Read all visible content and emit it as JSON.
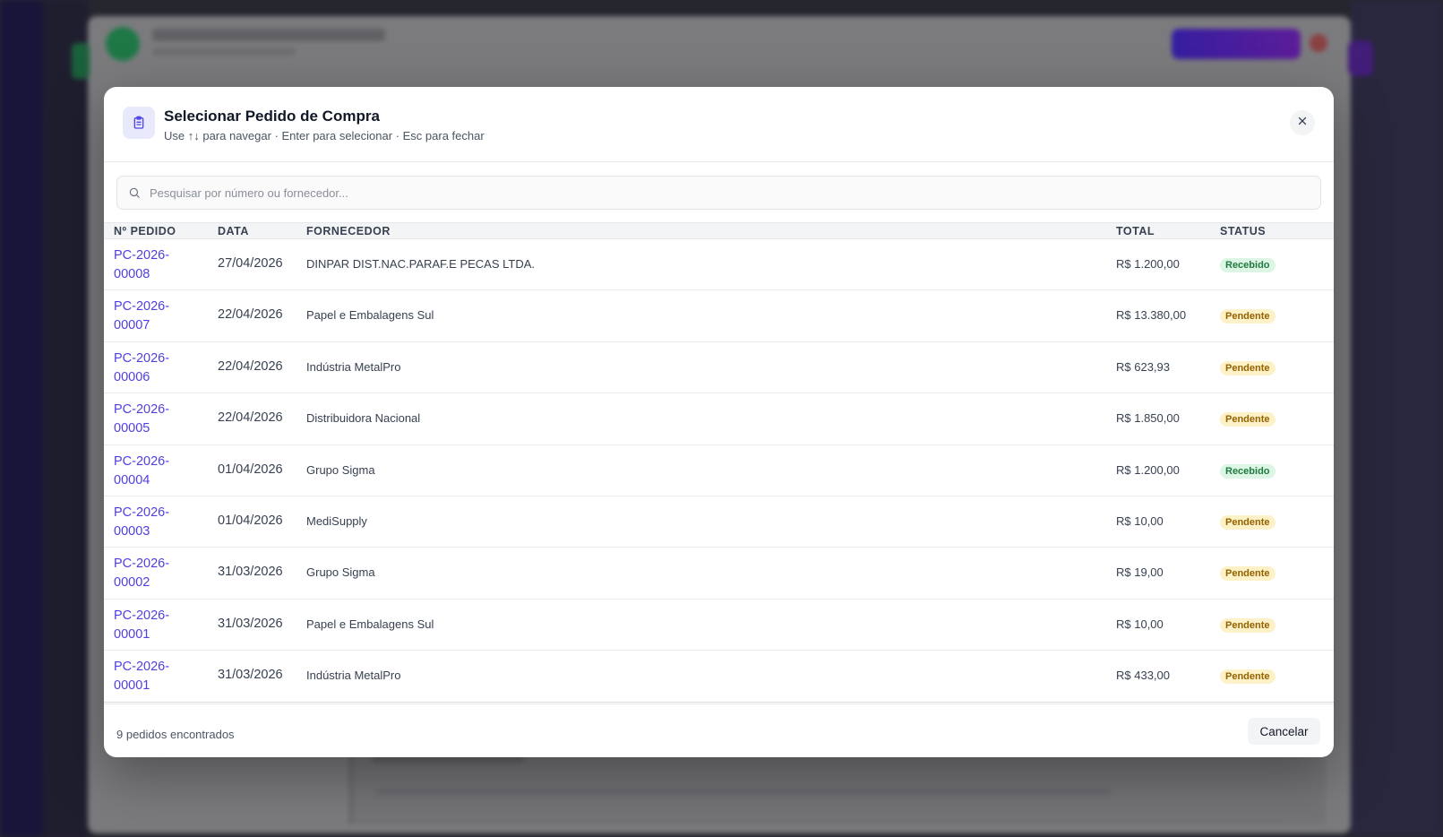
{
  "modal": {
    "title": "Selecionar Pedido de Compra",
    "subtitle": "Use ↑↓ para navegar · Enter para selecionar · Esc para fechar",
    "close_icon": "close-icon",
    "header_icon": "clipboard-icon"
  },
  "search": {
    "placeholder": "Pesquisar por número ou fornecedor...",
    "value": ""
  },
  "table": {
    "columns": [
      "Nº PEDIDO",
      "DATA",
      "FORNECEDOR",
      "TOTAL",
      "STATUS"
    ],
    "rows": [
      {
        "num_a": "PC-2026-",
        "num_b": "00008",
        "date": "27/04/2026",
        "supplier": "DINPAR DIST.NAC.PARAF.E PECAS LTDA.",
        "total": "R$ 1.200,00",
        "status": "Recebido"
      },
      {
        "num_a": "PC-2026-",
        "num_b": "00007",
        "date": "22/04/2026",
        "supplier": "Papel e Embalagens Sul",
        "total": "R$ 13.380,00",
        "status": "Pendente"
      },
      {
        "num_a": "PC-2026-",
        "num_b": "00006",
        "date": "22/04/2026",
        "supplier": "Indústria MetalPro",
        "total": "R$ 623,93",
        "status": "Pendente"
      },
      {
        "num_a": "PC-2026-",
        "num_b": "00005",
        "date": "22/04/2026",
        "supplier": "Distribuidora Nacional",
        "total": "R$ 1.850,00",
        "status": "Pendente"
      },
      {
        "num_a": "PC-2026-",
        "num_b": "00004",
        "date": "01/04/2026",
        "supplier": "Grupo Sigma",
        "total": "R$ 1.200,00",
        "status": "Recebido"
      },
      {
        "num_a": "PC-2026-",
        "num_b": "00003",
        "date": "01/04/2026",
        "supplier": "MediSupply",
        "total": "R$ 10,00",
        "status": "Pendente"
      },
      {
        "num_a": "PC-2026-",
        "num_b": "00002",
        "date": "31/03/2026",
        "supplier": "Grupo Sigma",
        "total": "R$ 19,00",
        "status": "Pendente"
      },
      {
        "num_a": "PC-2026-",
        "num_b": "00001",
        "date": "31/03/2026",
        "supplier": "Papel e Embalagens Sul",
        "total": "R$ 10,00",
        "status": "Pendente"
      },
      {
        "num_a": "PC-2026-",
        "num_b": "00001",
        "date": "31/03/2026",
        "supplier": "Indústria MetalPro",
        "total": "R$ 433,00",
        "status": "Pendente"
      }
    ]
  },
  "footer": {
    "count_text": "9 pedidos encontrados",
    "cancel_label": "Cancelar"
  },
  "colors": {
    "accent": "#4f3fe0",
    "recebido_bg": "#dcf5e4",
    "pendente_bg": "#fcf1c7"
  }
}
